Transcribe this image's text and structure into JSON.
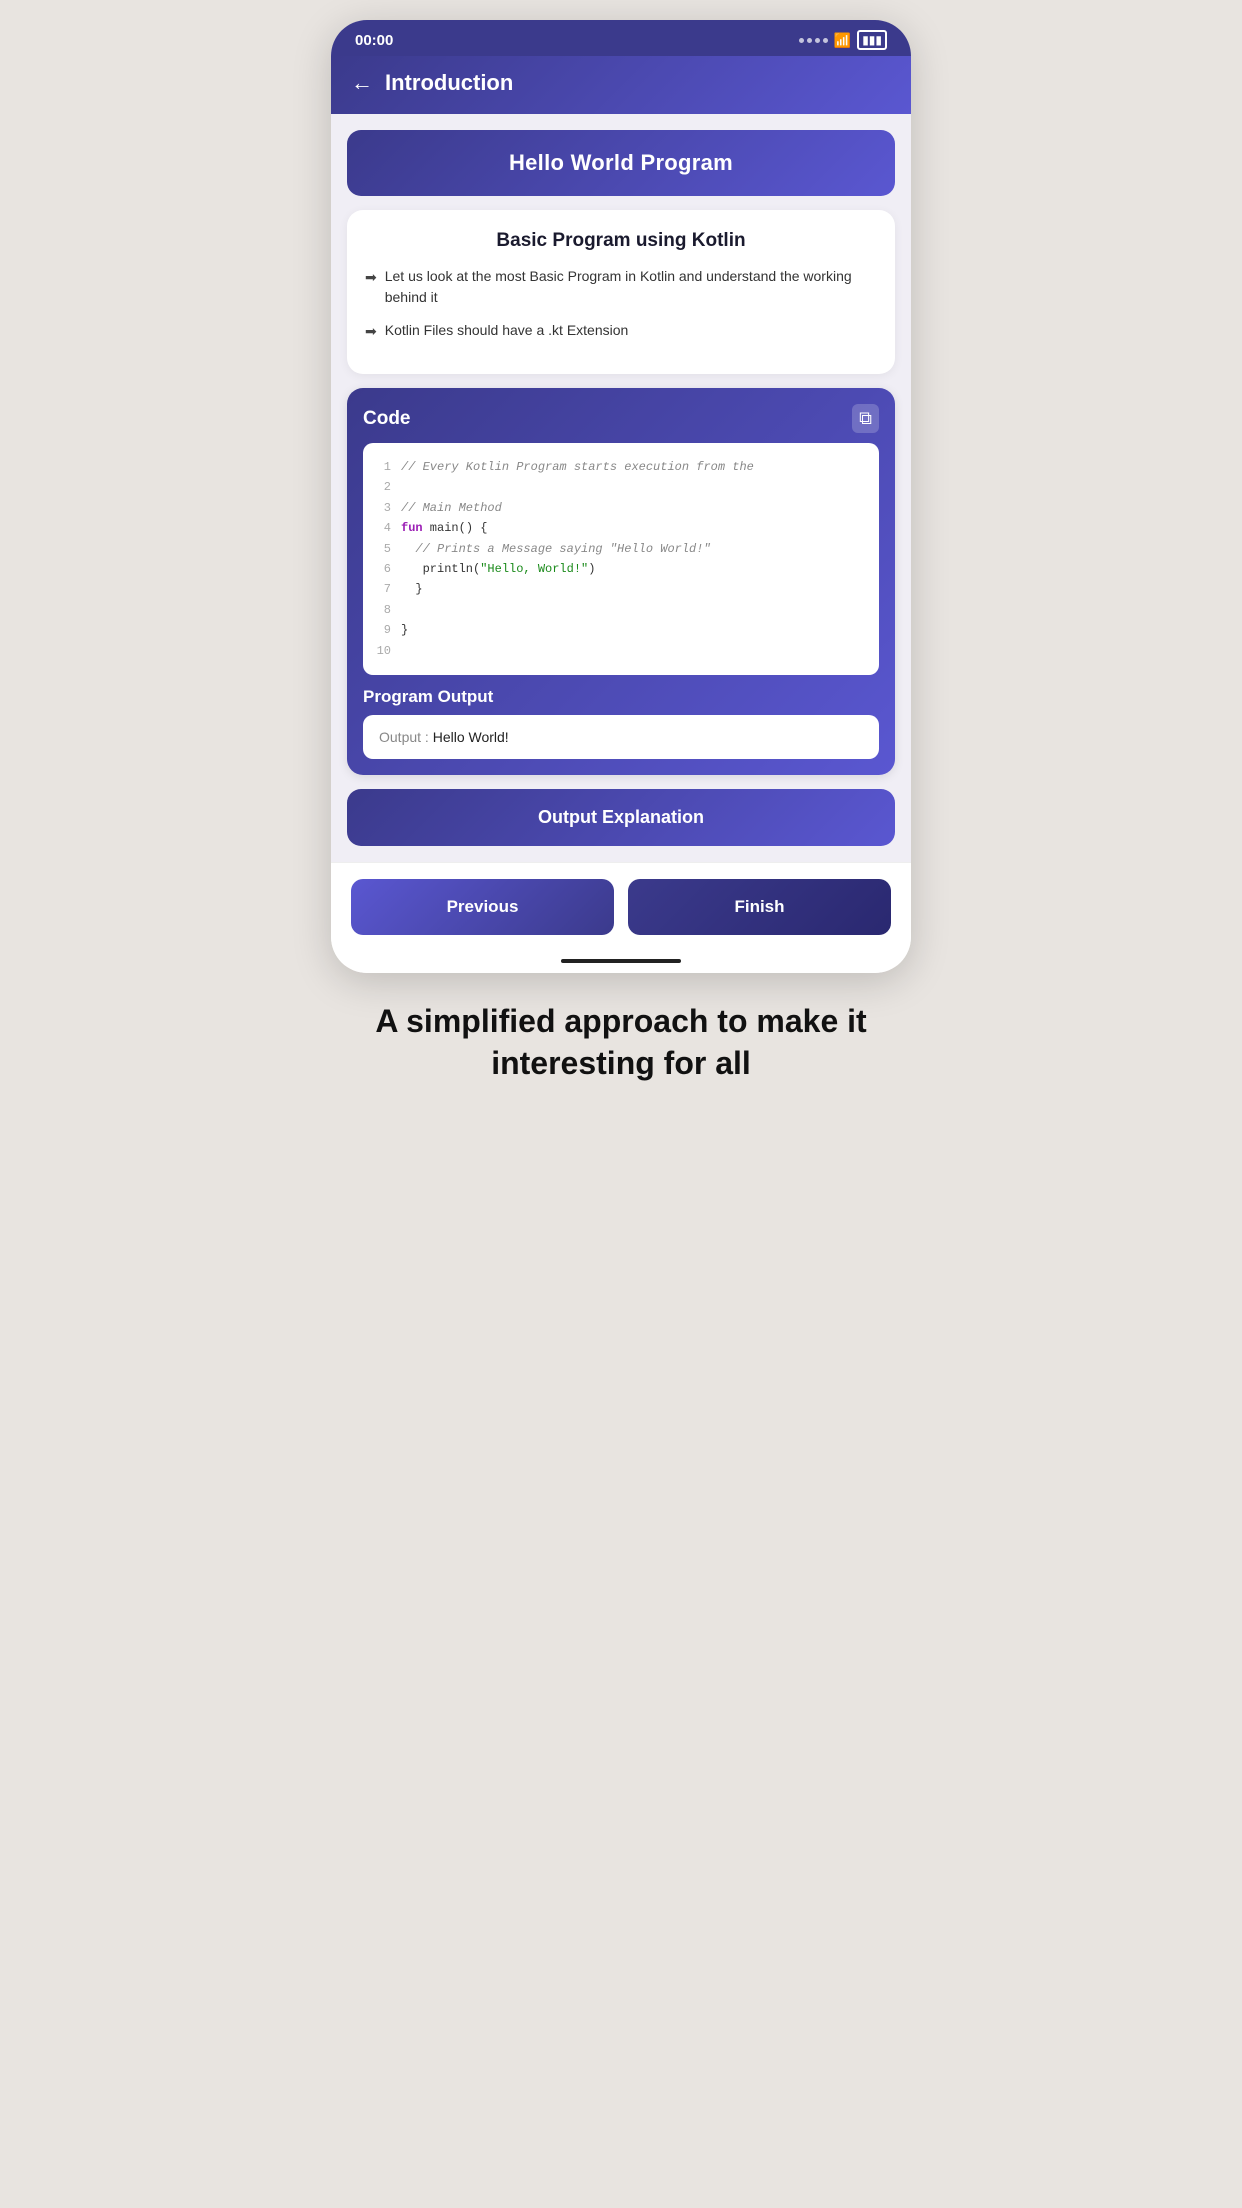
{
  "statusBar": {
    "time": "00:00"
  },
  "header": {
    "backLabel": "←",
    "title": "Introduction"
  },
  "heroBanner": {
    "title": "Hello World Program"
  },
  "infoCard": {
    "title": "Basic Program using Kotlin",
    "items": [
      "Let us look at the most Basic Program in Kotlin and understand the working behind it",
      "Kotlin Files should have a .kt Extension"
    ],
    "arrowSymbol": "➡"
  },
  "codeSection": {
    "label": "Code",
    "copyIcon": "⧉",
    "lines": [
      {
        "num": "1",
        "content": "// Every Kotlin Program starts execution from the",
        "type": "comment"
      },
      {
        "num": "2",
        "content": "",
        "type": "empty"
      },
      {
        "num": "3",
        "content": "// Main Method",
        "type": "comment"
      },
      {
        "num": "4",
        "content": "fun main() {",
        "type": "keyword_code"
      },
      {
        "num": "5",
        "content": "  // Prints a Message saying \"Hello World!\"",
        "type": "comment"
      },
      {
        "num": "6",
        "content": "  println(\"Hello, World!\")",
        "type": "string_code"
      },
      {
        "num": "7",
        "content": "  }",
        "type": "code"
      },
      {
        "num": "8",
        "content": "",
        "type": "empty"
      },
      {
        "num": "9",
        "content": "}",
        "type": "code"
      },
      {
        "num": "10",
        "content": "",
        "type": "empty"
      }
    ]
  },
  "outputSection": {
    "label": "Program Output",
    "outputKey": "Output :",
    "outputValue": " Hello World!"
  },
  "outputExplanation": {
    "title": "Output Explanation"
  },
  "buttons": {
    "previous": "Previous",
    "finish": "Finish"
  },
  "tagline": "A simplified approach to make it interesting for all"
}
